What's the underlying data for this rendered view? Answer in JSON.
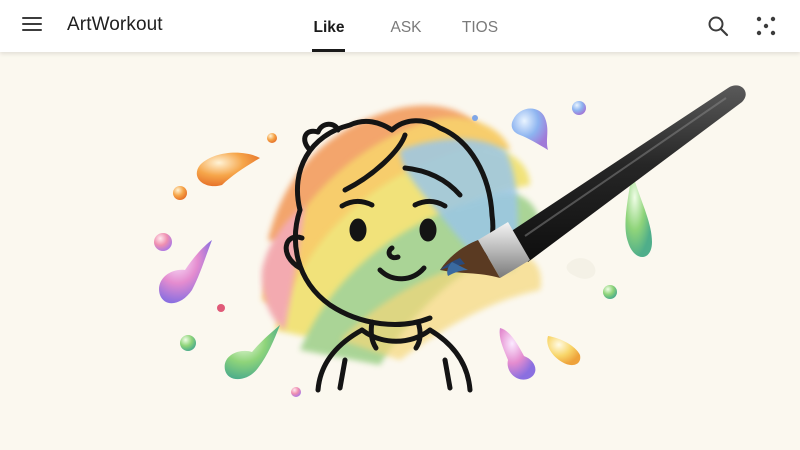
{
  "app": {
    "title": "ArtWorkout"
  },
  "header": {
    "menu_icon": "hamburger-menu-icon",
    "tabs": [
      {
        "label": "Like",
        "active": true
      },
      {
        "label": "ASK",
        "active": false
      },
      {
        "label": "TIOS",
        "active": false
      }
    ],
    "actions": [
      {
        "icon": "search-icon"
      },
      {
        "icon": "dots-grid-icon"
      }
    ]
  },
  "illustration": {
    "subject": "boy-face-line-drawing",
    "tool": "paintbrush-icon"
  },
  "colors": {
    "background": "#fbf8ef",
    "header": "#ffffff",
    "active_tab": "#1a1a1a",
    "inactive_tab": "#7a7a7a",
    "rainbow": [
      "#f29a5a",
      "#f7c85a",
      "#f0e06a",
      "#9fd08a",
      "#8ec0e6",
      "#f2a0a8"
    ]
  }
}
